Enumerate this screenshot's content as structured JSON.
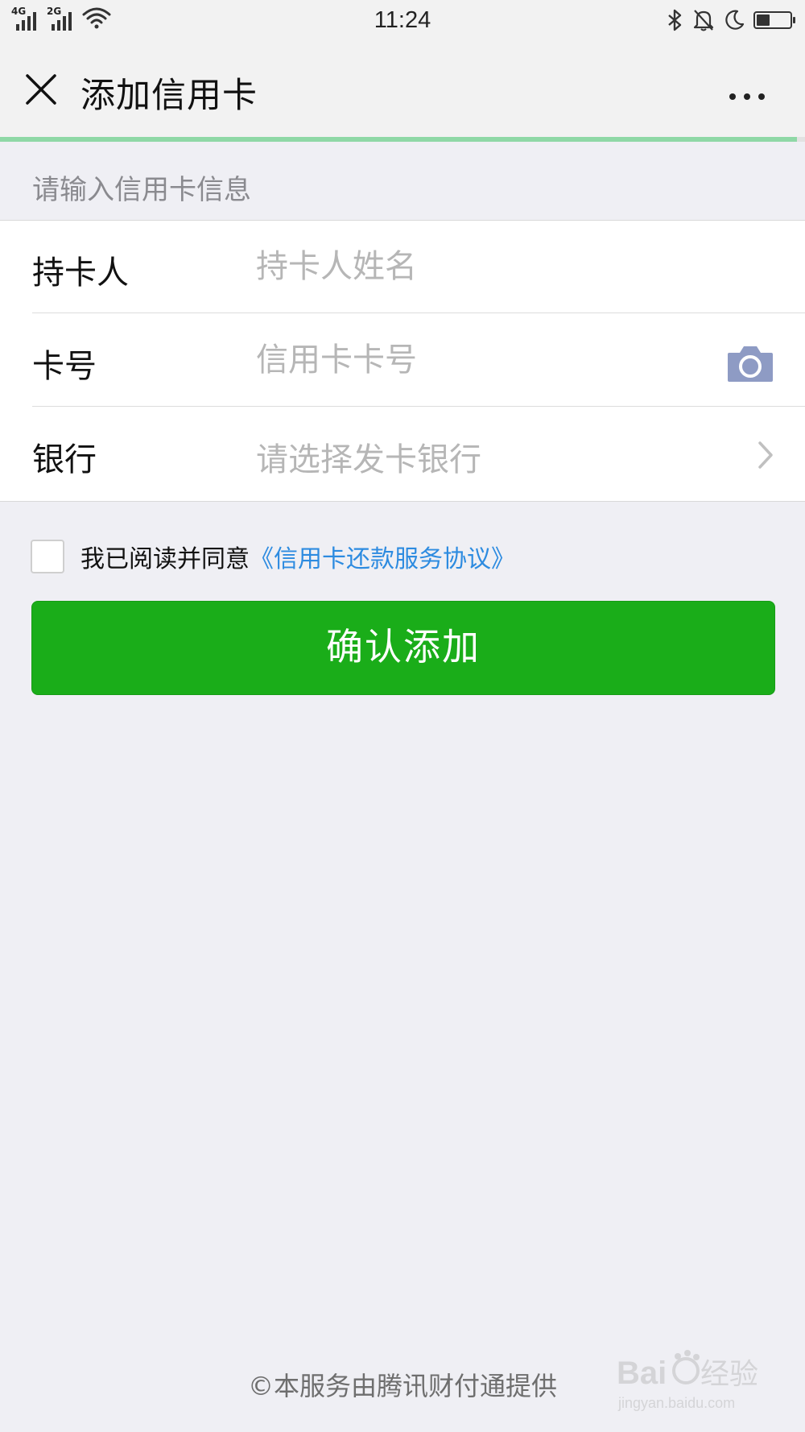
{
  "status_bar": {
    "network_1": "4G",
    "network_2": "2G",
    "time": "11:24",
    "icons": [
      "wifi-icon",
      "bluetooth-icon",
      "mute-bell-icon",
      "moon-icon",
      "battery-icon"
    ],
    "battery_level": 0.4
  },
  "nav": {
    "title": "添加信用卡",
    "close_icon": "close-icon",
    "more_icon": "more-icon"
  },
  "page_load_progress": 0.99,
  "form": {
    "section_title": "请输入信用卡信息",
    "holder_label": "持卡人",
    "holder_placeholder": "持卡人姓名",
    "holder_value": "",
    "card_label": "卡号",
    "card_placeholder": "信用卡卡号",
    "card_value": "",
    "card_scan_icon": "camera-icon",
    "bank_label": "银行",
    "bank_placeholder": "请选择发卡银行",
    "bank_arrow_icon": "chevron-right-icon"
  },
  "agreement": {
    "checked": false,
    "text": "我已阅读并同意",
    "link": "《信用卡还款服务协议》"
  },
  "confirm_button": "确认添加",
  "footer": "©本服务由腾讯财付通提供",
  "watermark": {
    "brand": "Baidu经验",
    "url": "jingyan.baidu.com"
  },
  "colors": {
    "primary_green": "#1aad19",
    "link_blue": "#2d8be0",
    "progress_green": "#8fd8a6",
    "background": "#efeff4"
  }
}
